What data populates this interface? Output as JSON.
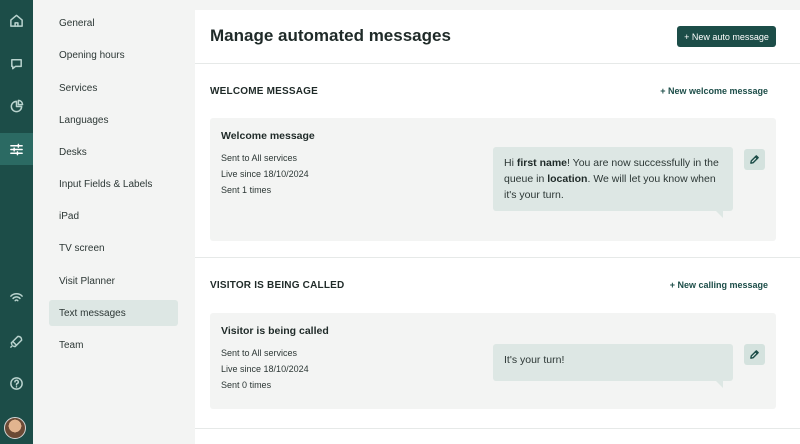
{
  "rail": {
    "icons": [
      "home-icon",
      "chat-icon",
      "pie-chart-icon",
      "sliders-icon",
      "wifi-icon",
      "rocket-icon",
      "help-icon"
    ],
    "active": "sliders-icon",
    "accent": "#1c4d48"
  },
  "subnav": {
    "items": [
      {
        "label": "General"
      },
      {
        "label": "Opening hours"
      },
      {
        "label": "Services"
      },
      {
        "label": "Languages"
      },
      {
        "label": "Desks"
      },
      {
        "label": "Input Fields & Labels"
      },
      {
        "label": "iPad"
      },
      {
        "label": "TV screen"
      },
      {
        "label": "Visit Planner"
      },
      {
        "label": "Text messages"
      },
      {
        "label": "Team"
      }
    ],
    "active": "Text messages"
  },
  "header": {
    "title": "Manage automated messages",
    "new_button": "+ New auto message"
  },
  "sections": [
    {
      "title": "WELCOME MESSAGE",
      "link": "+ New welcome message",
      "card": {
        "title": "Welcome message",
        "sent_to_label": "Sent to",
        "sent_to": "All services",
        "live_since_label": "Live since",
        "live_since": "18/10/2024",
        "sent_label": "Sent",
        "sent_count": "1",
        "sent_unit": "times",
        "message": {
          "p1": "Hi ",
          "b1": "first name",
          "p2": "! You are now successfully in the queue in ",
          "b2": "location",
          "p3": ". We will let you know when it's your turn."
        }
      }
    },
    {
      "title": "VISITOR IS BEING CALLED",
      "link": "+ New calling message",
      "card": {
        "title": "Visitor is being called",
        "sent_to_label": "Sent to",
        "sent_to": "All services",
        "live_since_label": "Live since",
        "live_since": "18/10/2024",
        "sent_label": "Sent",
        "sent_count": "0",
        "sent_unit": "times",
        "message": {
          "p1": "It's your turn!"
        }
      }
    }
  ]
}
